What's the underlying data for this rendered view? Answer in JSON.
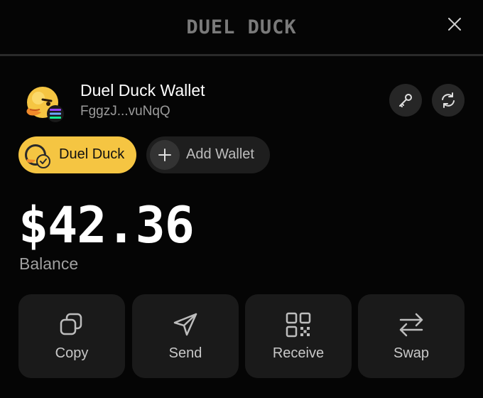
{
  "header": {
    "brand": "DUEL DUCK"
  },
  "wallet": {
    "name": "Duel Duck Wallet",
    "address": "FggzJ...vuNqQ"
  },
  "chips": {
    "active_label": "Duel Duck",
    "add_label": "Add Wallet"
  },
  "balance": {
    "amount": "$42.36",
    "label": "Balance"
  },
  "actions": {
    "copy": "Copy",
    "send": "Send",
    "receive": "Receive",
    "swap": "Swap"
  },
  "icons": [
    "close-icon",
    "duck-avatar",
    "solana-icon",
    "key-icon",
    "refresh-icon",
    "check-badge-icon",
    "plus-icon",
    "copy-icon",
    "send-icon",
    "qr-code-icon",
    "swap-icon"
  ],
  "colors": {
    "background": "#050505",
    "accent": "#f5c542",
    "card": "#1a1a1a",
    "muted_text": "#9b9b9b"
  }
}
